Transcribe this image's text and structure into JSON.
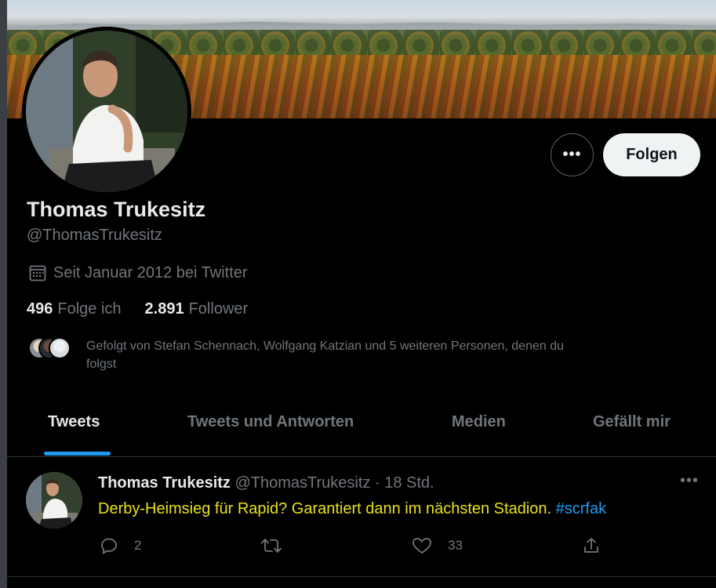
{
  "profile": {
    "name": "Thomas Trukesitz",
    "handle": "@ThomasTrukesitz",
    "joined": "Seit Januar 2012 bei Twitter",
    "following_count": "496",
    "following_label": "Folge ich",
    "followers_count": "2.891",
    "followers_label": "Follower",
    "followed_by_line1": "Gefolgt von Stefan Schennach, Wolfgang Katzian und 5 weiteren Personen, denen du",
    "followed_by_line2": "folgst"
  },
  "actions": {
    "follow_label": "Folgen",
    "more_label": "•••"
  },
  "tabs": [
    {
      "label": "Tweets",
      "active": true
    },
    {
      "label": "Tweets und Antworten",
      "active": false
    },
    {
      "label": "Medien",
      "active": false
    },
    {
      "label": "Gefällt mir",
      "active": false
    }
  ],
  "tweet": {
    "author_name": "Thomas Trukesitz",
    "author_handle": "@ThomasTrukesitz",
    "separator": " · ",
    "time": "18 Std.",
    "more_label": "•••",
    "text": "Derby-Heimsieg für Rapid? Garantiert dann im nächsten Stadion.",
    "hashtag": "#scrfak",
    "reply_count": "2",
    "retweet_count": "",
    "like_count": "33"
  },
  "icons": {
    "calendar": "calendar-icon",
    "reply": "reply-icon",
    "retweet": "retweet-icon",
    "like": "like-icon",
    "share": "share-icon"
  },
  "colors": {
    "background": "#000000",
    "accent": "#1d9bf0",
    "tweet_text": "#e9e11a",
    "muted": "#71767b",
    "primary_text": "#e7e9ea",
    "follow_button_bg": "#eff3f4"
  }
}
